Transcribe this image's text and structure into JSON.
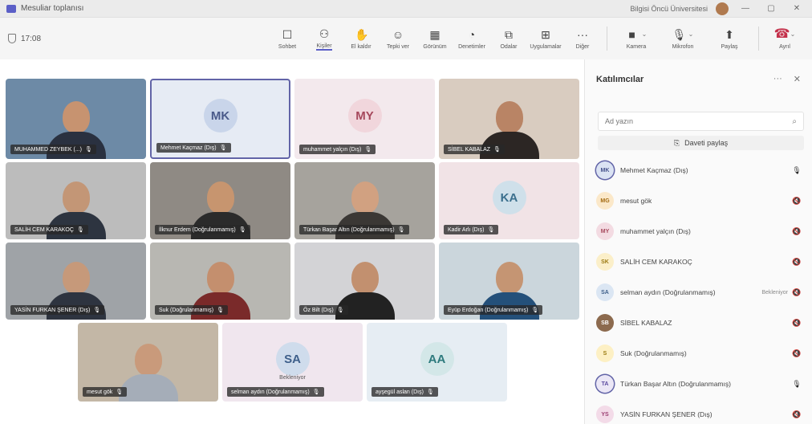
{
  "window": {
    "title": "Mesuliar toplanısı",
    "org": "Bilgisi Öncü Üniversitesi",
    "minimize": "—",
    "maximize": "▢",
    "close": "✕"
  },
  "toolbar": {
    "timer": "17:08",
    "items": [
      {
        "label": "Sohbet",
        "icon": "chat-icon",
        "glyph": "☐"
      },
      {
        "label": "Kişiler",
        "icon": "people-icon",
        "glyph": "⚇",
        "active": true
      },
      {
        "label": "El kaldır",
        "icon": "raise-hand-icon",
        "glyph": "✋"
      },
      {
        "label": "Tepki ver",
        "icon": "react-icon",
        "glyph": "☺"
      },
      {
        "label": "Görünüm",
        "icon": "view-icon",
        "glyph": "▦"
      },
      {
        "label": "Denetimler",
        "icon": "controls-icon",
        "glyph": "◔"
      },
      {
        "label": "Odalar",
        "icon": "rooms-icon",
        "glyph": "⧉"
      },
      {
        "label": "Uygulamalar",
        "icon": "apps-icon",
        "glyph": "⊞"
      },
      {
        "label": "Diğer",
        "icon": "more-icon",
        "glyph": "···"
      }
    ],
    "camera": "Kamera",
    "mic": "Mikrofon",
    "share": "Paylaş",
    "leave": "Ayrıl"
  },
  "tiles": [
    {
      "name": "MUHAMMED ZEYBEK (...)",
      "type": "video",
      "bg": "#6d8aa6",
      "skin": "#c79370",
      "shirt": "#2a3140"
    },
    {
      "name": "Mehmet Kaçmaz (Dış)",
      "type": "avatar",
      "initials": "MK",
      "avbg": "#c9d5ea",
      "avfg": "#4a5a8a",
      "bg": "#e6ebf4",
      "selected": true
    },
    {
      "name": "muhammet yalçın (Dış)",
      "type": "avatar",
      "initials": "MY",
      "avbg": "#f1d6dc",
      "avfg": "#a6485c",
      "bg": "#f3e9ed"
    },
    {
      "name": "SİBEL KABALAZ",
      "type": "video",
      "bg": "#d9ccc0",
      "skin": "#b98465",
      "shirt": "#2c2624"
    },
    {
      "name": "SALİH CEM KARAKOÇ",
      "type": "video",
      "bg": "#bcbcbc",
      "skin": "#c39676",
      "shirt": "#2d3440"
    },
    {
      "name": "İlknur Erdem (Doğrulanmamış)",
      "type": "video",
      "bg": "#8f8a84",
      "skin": "#c7956f",
      "shirt": "#2b2b2b"
    },
    {
      "name": "Türkan Başar Altın (Doğrulanmamış)",
      "type": "video",
      "bg": "#a6a39d",
      "skin": "#d1a181",
      "shirt": "#3b3835"
    },
    {
      "name": "Kadir Arlı (Dış)",
      "type": "avatar",
      "initials": "KA",
      "avbg": "#cfe0ea",
      "avfg": "#3b6f8d",
      "bg": "#f1e3e6"
    },
    {
      "name": "YASİN FURKAN ŞENER (Dış)",
      "type": "video",
      "bg": "#9fa3a7",
      "skin": "#c6997a",
      "shirt": "#2e3440"
    },
    {
      "name": "Suk (Doğrulanmamış)",
      "type": "video",
      "bg": "#b8b7b2",
      "skin": "#c48f6e",
      "shirt": "#7a2a2a"
    },
    {
      "name": "Öz Bilt (Dış)",
      "type": "video",
      "bg": "#d3d3d6",
      "skin": "#c2906f",
      "shirt": "#222"
    },
    {
      "name": "Eyüp Erdoğan (Doğrulanmamış)",
      "type": "video",
      "bg": "#cbd6dc",
      "skin": "#c59573",
      "shirt": "#24507a"
    },
    {
      "name": "mesut gök",
      "type": "video",
      "bg": "#c3b7a6",
      "skin": "#c99a7b",
      "shirt": "#a5adb8"
    },
    {
      "name": "selman aydın (Doğrulanmamış)",
      "type": "avatar",
      "initials": "SA",
      "avbg": "#cfdcec",
      "avfg": "#3e5f8a",
      "bg": "#f0e6ee",
      "caption": "Bekleniyor"
    },
    {
      "name": "ayşegül aslan (Dış)",
      "type": "avatar",
      "initials": "AA",
      "avbg": "#d3e7e8",
      "avfg": "#2d7a7d",
      "bg": "#e6edf3"
    }
  ],
  "panel": {
    "title": "Katılımcılar",
    "more": "···",
    "close": "✕",
    "search_placeholder": "Ad yazın",
    "share_invite": "Daveti paylaş",
    "participants": [
      {
        "initials": "MK",
        "name": "Mehmet Kaçmaz (Dış)",
        "avbg": "#dbe3f3",
        "avfg": "#44508a",
        "mic_on": true,
        "ring": true
      },
      {
        "initials": "MG",
        "name": "mesut gök",
        "avbg": "#fbe8c9",
        "avfg": "#a46b12",
        "mic_on": false
      },
      {
        "initials": "MY",
        "name": "muhammet yalçın (Dış)",
        "avbg": "#f3dbe2",
        "avfg": "#a6485c",
        "mic_on": false
      },
      {
        "initials": "SK",
        "name": "SALİH CEM KARAKOÇ",
        "avbg": "#fbefc9",
        "avfg": "#9c7a13",
        "mic_on": false
      },
      {
        "initials": "SA",
        "name": "selman aydın (Doğrulanmamış)",
        "avbg": "#dbe6f3",
        "avfg": "#3e5f8a",
        "mic_on": false,
        "extra": "Bekleniyor"
      },
      {
        "initials": "SB",
        "name": "SİBEL KABALAZ",
        "avbg": "#8c6a4e",
        "avfg": "#fff",
        "mic_on": false
      },
      {
        "initials": "S",
        "name": "Suk (Doğrulanmamış)",
        "avbg": "#fdf0c4",
        "avfg": "#9b7b10",
        "mic_on": false
      },
      {
        "initials": "TA",
        "name": "Türkan Başar Altın (Doğrulanmamış)",
        "avbg": "#ebe7f6",
        "avfg": "#5b4ba0",
        "mic_on": true,
        "ring": true
      },
      {
        "initials": "YS",
        "name": "YASİN FURKAN ŞENER (Dış)",
        "avbg": "#f3dbe8",
        "avfg": "#9b3f72",
        "mic_on": false
      }
    ]
  }
}
